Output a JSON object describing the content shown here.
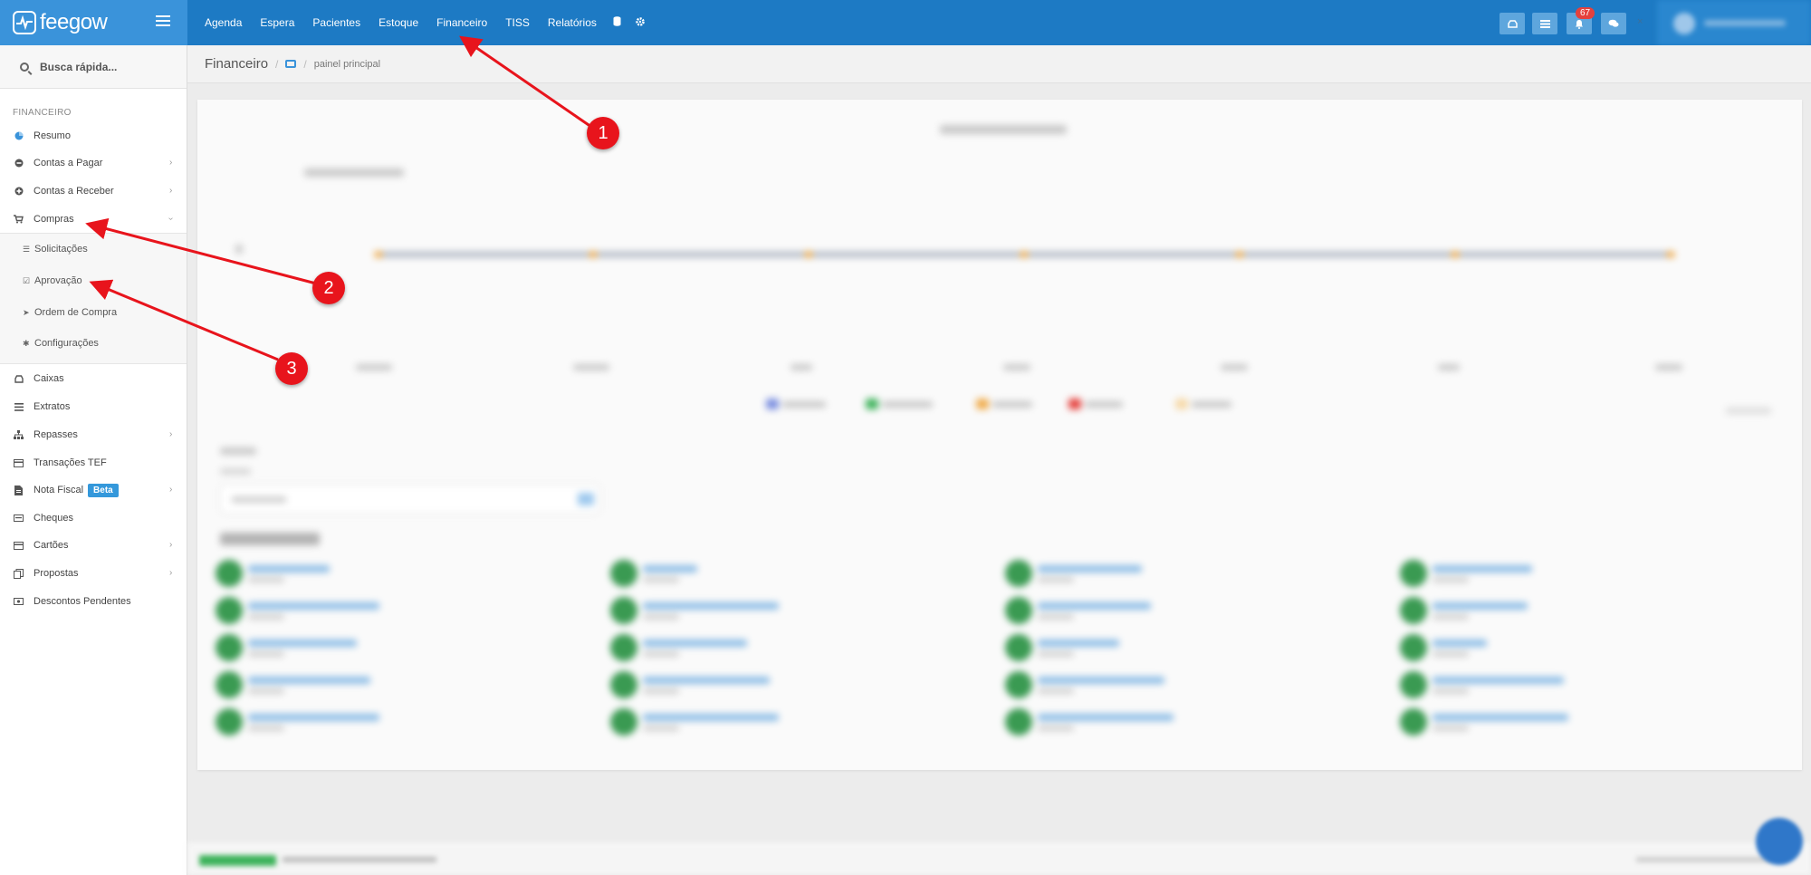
{
  "app": {
    "brand": "feegow",
    "accent": "#1d7ac4",
    "sidebar_accent": "#3a93da"
  },
  "topnav": {
    "items": [
      {
        "label": "Agenda"
      },
      {
        "label": "Espera"
      },
      {
        "label": "Pacientes"
      },
      {
        "label": "Estoque"
      },
      {
        "label": "Financeiro"
      },
      {
        "label": "TISS"
      },
      {
        "label": "Relatórios"
      }
    ],
    "icons": [
      "database-icon",
      "gear-icon"
    ],
    "right_buttons": [
      "inbox-icon",
      "list-icon",
      "bell-icon",
      "chat-icon"
    ],
    "notification_count": "67"
  },
  "search": {
    "placeholder": "Busca rápida..."
  },
  "sidebar": {
    "section": "FINANCEIRO",
    "items": [
      {
        "label": "Resumo",
        "icon": "pie-chart-icon"
      },
      {
        "label": "Contas a Pagar",
        "icon": "minus-circle-icon"
      },
      {
        "label": "Contas a Receber",
        "icon": "plus-circle-icon"
      },
      {
        "label": "Compras",
        "icon": "cart-icon"
      },
      {
        "label": "Caixas",
        "icon": "inbox-icon"
      },
      {
        "label": "Extratos",
        "icon": "list-icon"
      },
      {
        "label": "Repasses",
        "icon": "sitemap-icon"
      },
      {
        "label": "Transações TEF",
        "icon": "credit-card-icon"
      },
      {
        "label": "Nota Fiscal",
        "icon": "file-icon",
        "badge": "Beta"
      },
      {
        "label": "Cheques",
        "icon": "money-icon"
      },
      {
        "label": "Cartões",
        "icon": "card-icon"
      },
      {
        "label": "Propostas",
        "icon": "files-icon"
      },
      {
        "label": "Descontos Pendentes",
        "icon": "cash-icon"
      }
    ],
    "compras_sub": [
      {
        "label": "Solicitações",
        "icon": "list-icon"
      },
      {
        "label": "Aprovação",
        "icon": "check-square-icon"
      },
      {
        "label": "Ordem de Compra",
        "icon": "send-icon"
      },
      {
        "label": "Configurações",
        "icon": "gear-icon"
      }
    ]
  },
  "breadcrumb": {
    "title": "Financeiro",
    "separator": "/",
    "current": "painel principal"
  },
  "annotations": {
    "markers": [
      "1",
      "2",
      "3"
    ],
    "color": "#e8141c"
  }
}
